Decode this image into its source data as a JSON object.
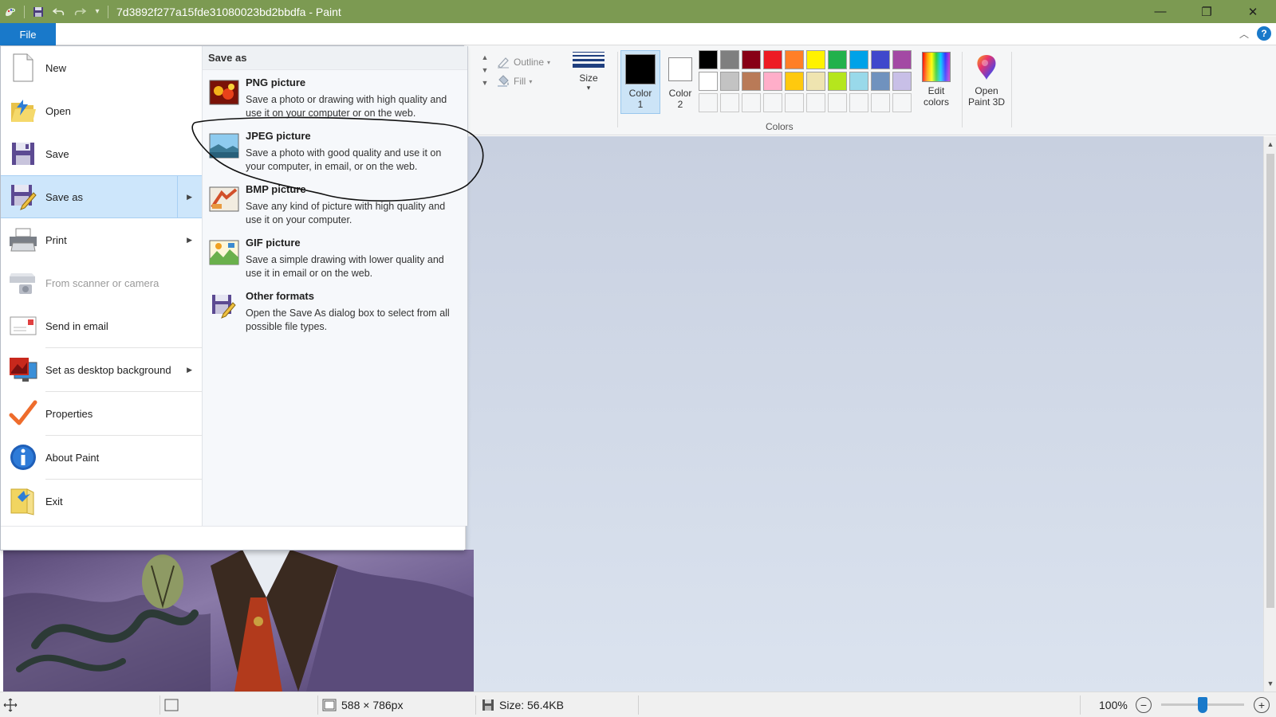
{
  "window": {
    "title": "7d3892f277a15fde31080023bd2bbdfa - Paint",
    "minimize_glyph": "—",
    "restore_glyph": "❐",
    "close_glyph": "✕"
  },
  "quick_access": {
    "app_icon": "paint-app-icon",
    "save_icon": "save-icon",
    "undo_icon": "undo-icon",
    "redo_icon": "redo-icon",
    "customize_glyph": "▾"
  },
  "tabs": {
    "file_label": "File",
    "help_glyph": "?",
    "collapse_glyph": "︿"
  },
  "ribbon": {
    "outline_label": "Outline",
    "fill_label": "Fill",
    "size_label": "Size",
    "size_arrow": "▾",
    "color1_label": "Color",
    "color1_num": "1",
    "color2_label": "Color",
    "color2_num": "2",
    "color1_value": "#000000",
    "color2_value": "#ffffff",
    "colors_group_label": "Colors",
    "edit_colors_line1": "Edit",
    "edit_colors_line2": "colors",
    "paint3d_line1": "Open",
    "paint3d_line2": "Paint 3D",
    "palette": [
      "#000000",
      "#7f7f7f",
      "#880015",
      "#ed1c24",
      "#ff7f27",
      "#fff200",
      "#22b14c",
      "#00a2e8",
      "#3f48cc",
      "#a349a4",
      "#ffffff",
      "#c3c3c3",
      "#b97a57",
      "#ffaec9",
      "#ffc90e",
      "#efe4b0",
      "#b5e61d",
      "#99d9ea",
      "#7092be",
      "#c8bfe7"
    ]
  },
  "file_menu": {
    "items": [
      {
        "label": "New",
        "icon": "new-file-icon"
      },
      {
        "label": "Open",
        "icon": "open-folder-icon"
      },
      {
        "label": "Save",
        "icon": "save-icon"
      },
      {
        "label": "Save as",
        "icon": "save-as-icon"
      },
      {
        "label": "Print",
        "icon": "printer-icon"
      },
      {
        "label": "From scanner or camera",
        "icon": "scanner-icon"
      },
      {
        "label": "Send in email",
        "icon": "email-icon"
      },
      {
        "label": "Set as desktop background",
        "icon": "desktop-background-icon"
      },
      {
        "label": "Properties",
        "icon": "checkmark-icon"
      },
      {
        "label": "About Paint",
        "icon": "info-icon"
      },
      {
        "label": "Exit",
        "icon": "exit-icon"
      }
    ],
    "submenu_arrow": "▶",
    "save_as_panel": {
      "header": "Save as",
      "formats": [
        {
          "name": "PNG picture",
          "desc": "Save a photo or drawing with high quality and use it on your computer or on the web.",
          "icon": "png-picture-icon"
        },
        {
          "name": "JPEG picture",
          "desc": "Save a photo with good quality and use it on your computer, in email, or on the web.",
          "icon": "jpeg-picture-icon"
        },
        {
          "name": "BMP picture",
          "desc": "Save any kind of picture with high quality and use it on your computer.",
          "icon": "bmp-picture-icon"
        },
        {
          "name": "GIF picture",
          "desc": "Save a simple drawing with lower quality and use it in email or on the web.",
          "icon": "gif-picture-icon"
        },
        {
          "name": "Other formats",
          "desc": "Open the Save As dialog box to select from all possible file types.",
          "icon": "other-formats-icon"
        }
      ]
    }
  },
  "status_bar": {
    "dimensions": "588 × 786px",
    "file_size": "Size: 56.4KB",
    "zoom": "100%",
    "zoom_out_glyph": "−",
    "zoom_in_glyph": "+",
    "zoom_fraction": 0.5
  }
}
